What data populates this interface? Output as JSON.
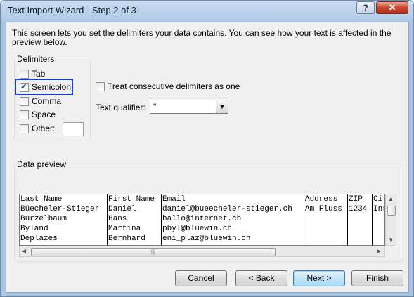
{
  "window": {
    "title": "Text Import Wizard - Step 2 of 3",
    "help_glyph": "?",
    "close_glyph": "✕"
  },
  "description": "This screen lets you set the delimiters your data contains.  You can see how your text is affected in the preview below.",
  "delimiters": {
    "group_label": "Delimiters",
    "items": [
      {
        "label": "Tab",
        "checked": false
      },
      {
        "label": "Semicolon",
        "checked": true
      },
      {
        "label": "Comma",
        "checked": false
      },
      {
        "label": "Space",
        "checked": false
      },
      {
        "label": "Other:",
        "checked": false
      }
    ],
    "other_value": ""
  },
  "consecutive": {
    "label": "Treat consecutive delimiters as one",
    "checked": false
  },
  "qualifier": {
    "label": "Text qualifier:",
    "value": "\"",
    "arrow": "▼"
  },
  "preview": {
    "group_label": "Data preview",
    "columns": [
      {
        "cells": [
          "Last Name",
          "Büecheler-Stieger",
          "Burzelbaum",
          "Byland",
          "Deplazes"
        ]
      },
      {
        "cells": [
          "First Name",
          "Daniel",
          "Hans",
          "Martina",
          "Bernhard"
        ]
      },
      {
        "cells": [
          "Email",
          "daniel@bueecheler-stieger.ch",
          "hallo@internet.ch",
          "pbyl@bluewin.ch",
          "eni_plaz@bluewin.ch"
        ]
      },
      {
        "cells": [
          "Address",
          "Am Fluss",
          "",
          "",
          ""
        ]
      },
      {
        "cells": [
          "ZIP",
          "1234",
          "",
          "",
          ""
        ]
      },
      {
        "cells": [
          "City",
          "Ins",
          "",
          "",
          ""
        ]
      }
    ]
  },
  "buttons": {
    "cancel": "Cancel",
    "back": "< Back",
    "next": "Next >",
    "finish": "Finish"
  },
  "colors": {
    "focus": "#1a3acf",
    "default_button": "#3c7fb1",
    "close": "#c7452e"
  }
}
